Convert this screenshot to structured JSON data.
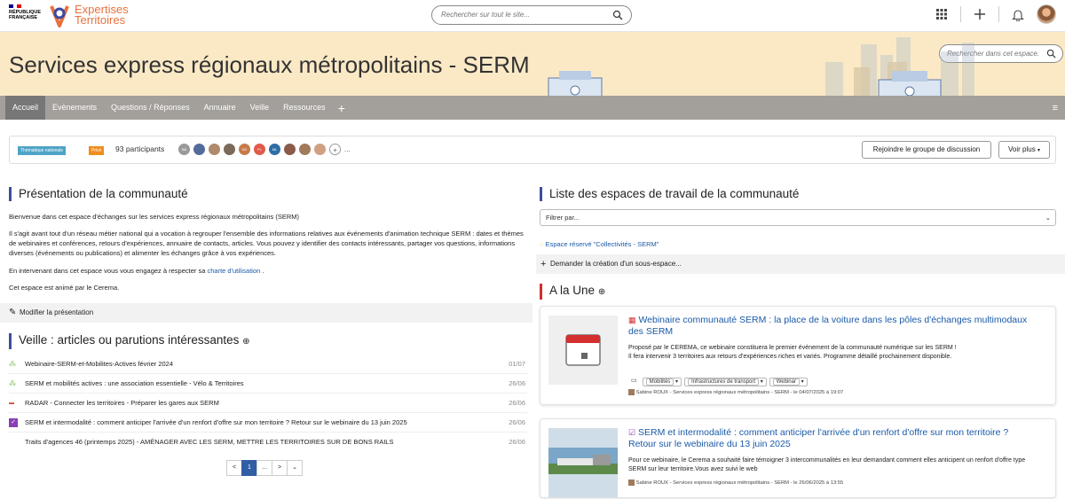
{
  "header": {
    "rf_text": [
      "RÉPUBLIQUE",
      "FRANÇAISE"
    ],
    "brand_line1": "Expertises",
    "brand_line2": "Territoires",
    "search_placeholder": "Rechercher sur tout le site..."
  },
  "banner": {
    "title": "Services express régionaux métropolitains - SERM",
    "search_placeholder": "Rechercher dans cet espace."
  },
  "nav": {
    "tabs": [
      "Accueil",
      "Evènements",
      "Questions / Réponses",
      "Annuaire",
      "Veille",
      "Ressources"
    ],
    "add": "+"
  },
  "info": {
    "tag1": "Thématique nationale",
    "tag2": "Privé",
    "participants": "93 participants",
    "avatar_initials": [
      "BB",
      "KD",
      "PL",
      "ML"
    ],
    "more": "...",
    "join_button": "Rejoindre le groupe de discussion",
    "voir_plus": "Voir plus"
  },
  "presentation": {
    "title": "Présentation de la communauté",
    "p1": "Bienvenue dans cet espace d'échanges sur les services express régionaux métropolitains (SERM)",
    "p2": "Il s'agit avant tout d'un réseau métier national qui a vocation à regrouper l'ensemble des informations relatives aux événements d'animation technique SERM : dates et thèmes de webinaires et conférences, retours d'expériences, annuaire de contacts, articles. Vous pouvez y identifier des contacts intéressants, partager vos questions, informations diverses (événements ou publications) et alimenter les échanges grâce à vos expériences.",
    "p3_before": "En intervenant dans cet espace vous vous engagez à respecter sa ",
    "p3_link": "charte d'utilisation",
    "p3_after": " .",
    "p4": "Cet espace est animé par le Cerema.",
    "modify": "Modifier la présentation"
  },
  "veille": {
    "title": "Veille : articles ou parutions intéressantes",
    "items": [
      {
        "title": "Webinaire-SERM-et-Mobilites-Actives février 2024",
        "date": "01/07"
      },
      {
        "title": "SERM et mobilités actives : une association essentielle - Vélo & Territoires",
        "date": "26/06"
      },
      {
        "title": "RADAR - Connecter les territoires - Préparer les gares aux SERM",
        "date": "26/06"
      },
      {
        "title": "SERM et intermodalité : comment anticiper l'arrivée d'un renfort d'offre sur mon territoire ? Retour sur le webinaire du 13 juin 2025",
        "date": "26/06"
      },
      {
        "title": "Traits d'agences 46 (printemps 2025) - AMÉNAGER AVEC LES SERM, METTRE LES TERRITOIRES SUR DE BONS RAILS",
        "date": "26/06"
      }
    ],
    "pager": [
      "<",
      "1",
      "...",
      ">",
      "⌄"
    ]
  },
  "workspaces": {
    "title": "Liste des espaces de travail de la communauté",
    "filter_placeholder": "Filtrer par...",
    "espace_link": "Espace réservé \"Collectivités - SERM\"",
    "request": "Demander la création d'un sous-espace..."
  },
  "une": {
    "title": "A la Une",
    "cards": [
      {
        "title": "Webinaire communauté SERM : la place de la voiture dans les pôles d'échanges multimodaux des SERM",
        "desc1": "Proposé par le CEREMA, ce webinaire constituera le premier événement de la communauté numérique sur les SERM !",
        "desc2": "Il fera intervenir 3 territoires aux retours d'expériences riches et variés. Programme détaillé prochainement disponible.",
        "tags": [
          "Mobilités",
          "Infrastructures de transport",
          "Webinar"
        ],
        "by": "Sabine ROUX - Services express régionaux métropolitains - SERM - le 04/07/2025 à 19:07"
      },
      {
        "title": "SERM et intermodalité : comment anticiper l'arrivée d'un renfort d'offre sur mon territoire ? Retour sur le webinaire du 13 juin 2025",
        "desc1": "Pour ce webinaire, le Cerema a souhaité faire témoigner 3 intercommunalités en leur demandant comment elles anticipent un renfort d'offre type SERM sur leur territoire.Vous avez suivi le web",
        "by": "Sabine ROUX - Services express régionaux métropolitains - SERM - le 26/06/2025 à 13:55"
      }
    ]
  }
}
